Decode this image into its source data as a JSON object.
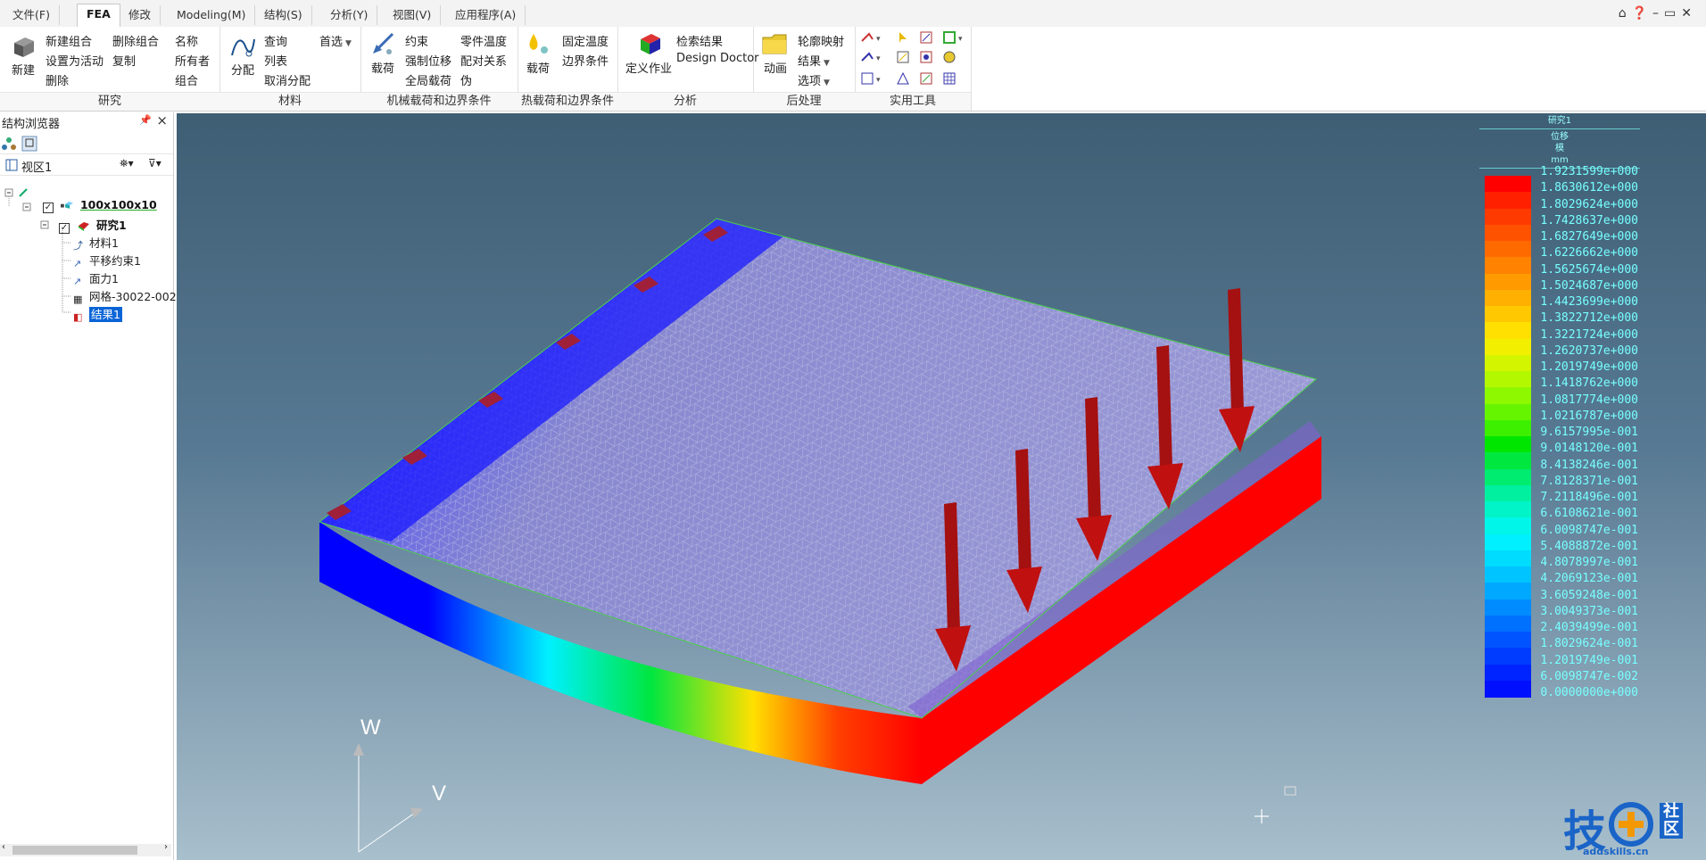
{
  "menu": {
    "tabs": [
      "文件(F)",
      "FEA",
      "修改",
      "Modeling(M)",
      "结构(S)",
      "分析(Y)",
      "视图(V)",
      "应用程序(A)"
    ],
    "active": "FEA"
  },
  "ribbon": {
    "study": {
      "new_label": "新建",
      "new_group": "新建组合",
      "delete_group": "删除组合",
      "set_active": "设置为活动",
      "copy": "复制",
      "delete": "删除",
      "label": "研究"
    },
    "material": {
      "name": "名称",
      "owner": "所有者",
      "combo": "组合",
      "assign": "分配",
      "query": "查询",
      "list": "列表",
      "unassign": "取消分配",
      "prefs": "首选",
      "label": "材料"
    },
    "mech": {
      "load": "载荷",
      "constraint": "约束",
      "enforced_disp": "强制位移",
      "global_load": "全局载荷",
      "part_temp": "零件温度",
      "mating": "配对关系",
      "pseudo": "伪",
      "label": "机械载荷和边界条件"
    },
    "thermal": {
      "load": "载荷",
      "fixed_temp": "固定温度",
      "boundary": "边界条件",
      "label": "热载荷和边界条件"
    },
    "analysis": {
      "define_job": "定义作业",
      "check": "检索结果",
      "doctor": "Design Doctor",
      "label": "分析"
    },
    "post": {
      "animate": "动画",
      "contour": "轮廓映射",
      "results": "结果",
      "options": "选项",
      "label": "后处理"
    },
    "tools": {
      "label": "实用工具"
    }
  },
  "browser": {
    "title": "结构浏览器",
    "view": "视区1",
    "tree": {
      "part": "100x100x10",
      "study": "研究1",
      "children": [
        "材料1",
        "平移约束1",
        "面力1",
        "网格-30022-002",
        "结果1"
      ]
    }
  },
  "legend": {
    "title": "研究1",
    "subtitle": [
      "位移",
      "模",
      "mm"
    ],
    "values": [
      "1.9231599e+000",
      "1.8630612e+000",
      "1.8029624e+000",
      "1.7428637e+000",
      "1.6827649e+000",
      "1.6226662e+000",
      "1.5625674e+000",
      "1.5024687e+000",
      "1.4423699e+000",
      "1.3822712e+000",
      "1.3221724e+000",
      "1.2620737e+000",
      "1.2019749e+000",
      "1.1418762e+000",
      "1.0817774e+000",
      "1.0216787e+000",
      "9.6157995e-001",
      "9.0148120e-001",
      "8.4138246e-001",
      "7.8128371e-001",
      "7.2118496e-001",
      "6.6108621e-001",
      "6.0098747e-001",
      "5.4088872e-001",
      "4.8078997e-001",
      "4.2069123e-001",
      "3.6059248e-001",
      "3.0049373e-001",
      "2.4039499e-001",
      "1.8029624e-001",
      "1.2019749e-001",
      "6.0098747e-002",
      "0.0000000e+000"
    ],
    "colors": [
      "#ff0000",
      "#ff2000",
      "#ff3a00",
      "#ff5200",
      "#ff6a00",
      "#ff8200",
      "#ff9a00",
      "#ffb000",
      "#ffc800",
      "#ffe000",
      "#f2f000",
      "#d4f500",
      "#b4f800",
      "#8ef800",
      "#66f500",
      "#3cf000",
      "#00e600",
      "#00e840",
      "#00ec70",
      "#00f0a0",
      "#00f4c8",
      "#00f6e8",
      "#00f0ff",
      "#00dcff",
      "#00c4ff",
      "#00a8ff",
      "#008cff",
      "#0070ff",
      "#0054ff",
      "#003cff",
      "#0024ff",
      "#0010ff",
      "#0000ff"
    ]
  },
  "axes": {
    "w": "W",
    "v": "V"
  },
  "watermark": {
    "main": "技",
    "plus": "社区",
    "url": "addskills.cn"
  }
}
